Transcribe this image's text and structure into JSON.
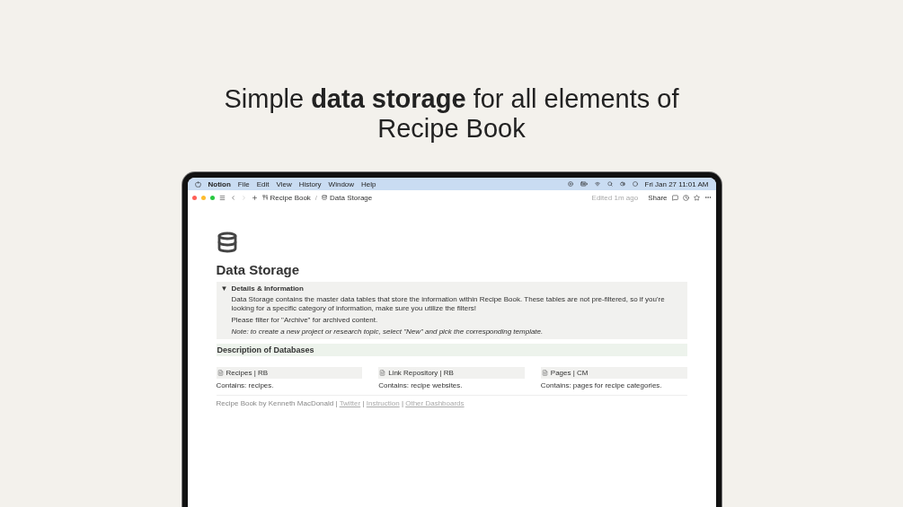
{
  "headline": "Simple **data storage** for all elements of Recipe Book",
  "menu_bar": {
    "app": "Notion",
    "menus": [
      "File",
      "Edit",
      "View",
      "History",
      "Window",
      "Help"
    ],
    "clock": "Fri Jan 27  11:01 AM"
  },
  "toolbar": {
    "separator": "/",
    "breadcrumbs": [
      {
        "kind": "book",
        "label": "Recipe Book"
      },
      {
        "kind": "database",
        "label": "Data Storage"
      }
    ],
    "edited": "Edited 1m ago",
    "share": "Share"
  },
  "page": {
    "title": "Data Storage",
    "toggle": {
      "arrow": "▼",
      "title": "Details & Information",
      "expanded": true,
      "paragraphs": [
        {
          "kind": "plain",
          "text": "Data Storage contains the master data tables that store the information within Recipe Book. These tables are not pre-filtered, so if you're looking for a specific category of information, make sure you utilize the filters!"
        },
        {
          "kind": "plain",
          "text": "Please filter for \"Archive\" for archived content."
        },
        {
          "kind": "italic",
          "text": "Note: to create a new project or research topic, select \"New\" and pick the corresponding template."
        }
      ]
    },
    "section_heading": "Description of Databases",
    "databases": [
      {
        "name": "Recipes | RB",
        "description": "Contains: recipes."
      },
      {
        "name": "Link Repository | RB",
        "description": "Contains: recipe websites."
      },
      {
        "name": "Pages | CM",
        "description": "Contains: pages for recipe categories."
      }
    ],
    "footer": [
      {
        "kind": "text",
        "text": "Recipe Book by Kenneth MacDonald |"
      },
      {
        "kind": "link",
        "text": "Twitter"
      },
      {
        "kind": "text",
        "text": "|"
      },
      {
        "kind": "link",
        "text": "Instruction"
      },
      {
        "kind": "text",
        "text": "|"
      },
      {
        "kind": "link",
        "text": "Other Dashboards"
      }
    ]
  }
}
